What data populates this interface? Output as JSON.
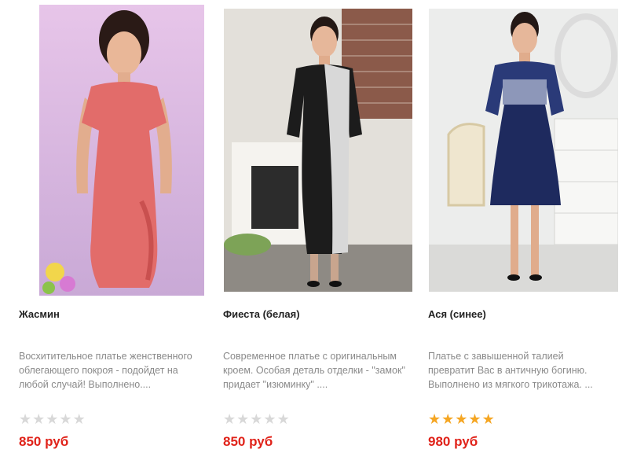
{
  "products": [
    {
      "title": "Жасмин",
      "description": "Восхитительное платье женственного облегающего покроя - подойдет на любой случай! Выполнено....",
      "price": "850 руб",
      "rating": 0,
      "dress_color": "#e26c6a",
      "background_color": "#e8c6e8"
    },
    {
      "title": "Фиеста (белая)",
      "description": "Современное платье с оригинальным кроем. Особая деталь отделки - \"замок\" придает \"изюминку\" ....",
      "price": "850 руб",
      "rating": 0,
      "dress_color": "#1c1c1c",
      "background_color": "#d9d6cf"
    },
    {
      "title": "Ася (синее)",
      "description": "Платье с завышенной талией превратит Вас в античную богиню. Выполнено из мягкого трикотажа. ...",
      "price": "980 руб",
      "rating": 5,
      "dress_color": "#1e2a5e",
      "background_color": "#e9ebea"
    }
  ],
  "colors": {
    "price": "#e0231a",
    "star_on": "#f5a623",
    "star_off": "#d8d8d8",
    "text": "#222222",
    "muted": "#8a8a8a"
  },
  "icons": {
    "star": "star-icon"
  }
}
